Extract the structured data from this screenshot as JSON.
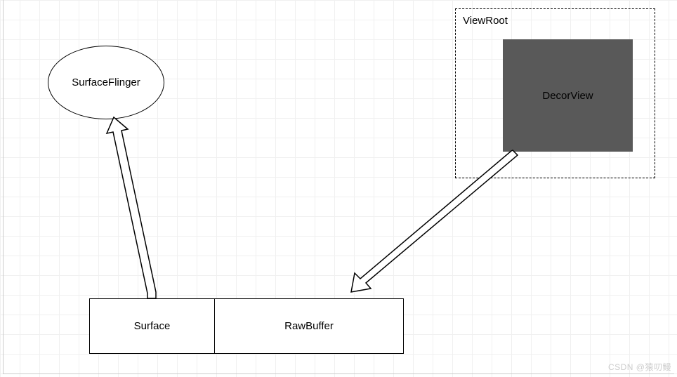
{
  "nodes": {
    "surfaceFlinger": {
      "label": "SurfaceFlinger"
    },
    "viewRoot": {
      "label": "ViewRoot"
    },
    "decorView": {
      "label": "DecorView"
    },
    "surface": {
      "label": "Surface"
    },
    "rawBuffer": {
      "label": "RawBuffer"
    }
  },
  "watermark": "CSDN @猿叨鳗"
}
